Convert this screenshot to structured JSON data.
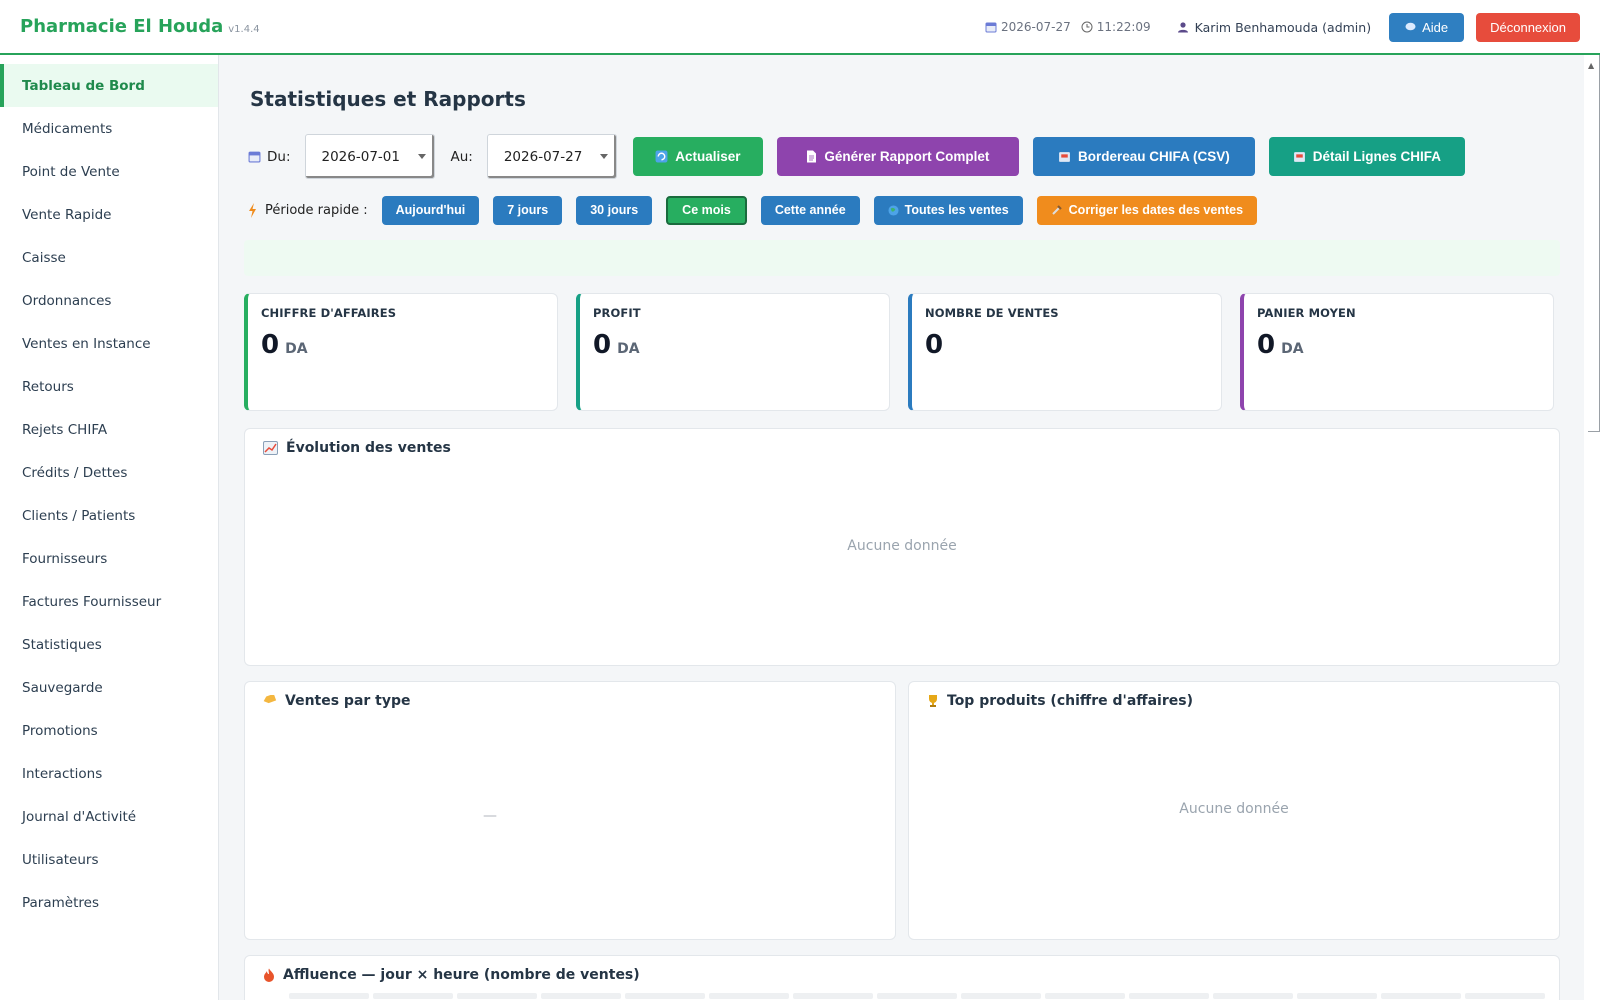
{
  "header": {
    "app_name": "Pharmacie El Houda",
    "version": "v1.4.4",
    "date": "2026-07-27",
    "time": "11:22:09",
    "user": "Karim Benhamouda (admin)",
    "help_label": "Aide",
    "logout_label": "Déconnexion"
  },
  "sidebar": {
    "items": [
      {
        "label": "Tableau de Bord"
      },
      {
        "label": "Médicaments"
      },
      {
        "label": "Point de Vente"
      },
      {
        "label": "Vente Rapide"
      },
      {
        "label": "Caisse"
      },
      {
        "label": "Ordonnances"
      },
      {
        "label": "Ventes en Instance"
      },
      {
        "label": "Retours"
      },
      {
        "label": "Rejets CHIFA"
      },
      {
        "label": "Crédits / Dettes"
      },
      {
        "label": "Clients / Patients"
      },
      {
        "label": "Fournisseurs"
      },
      {
        "label": "Factures Fournisseur"
      },
      {
        "label": "Statistiques"
      },
      {
        "label": "Sauvegarde"
      },
      {
        "label": "Promotions"
      },
      {
        "label": "Interactions"
      },
      {
        "label": "Journal d'Activité"
      },
      {
        "label": "Utilisateurs"
      },
      {
        "label": "Paramètres"
      }
    ],
    "active_index": 0
  },
  "page": {
    "title": "Statistiques et Rapports"
  },
  "filters": {
    "from_label": "Du:",
    "from_value": "2026-07-01",
    "to_label": "Au:",
    "to_value": "2026-07-27",
    "refresh_label": "Actualiser",
    "report_label": "Générer Rapport Complet",
    "chifa_csv_label": "Bordereau CHIFA (CSV)",
    "chifa_detail_label": "Détail Lignes CHIFA"
  },
  "quick": {
    "label": "Période rapide :",
    "today": "Aujourd'hui",
    "days7": "7 jours",
    "days30": "30 jours",
    "month": "Ce mois",
    "year": "Cette année",
    "all": "Toutes les ventes",
    "fix_dates": "Corriger les dates des ventes",
    "active": "month"
  },
  "kpis": {
    "revenue": {
      "label": "CHIFFRE D'AFFAIRES",
      "value": "0",
      "unit": "DA",
      "color": "#27ae60"
    },
    "profit": {
      "label": "PROFIT",
      "value": "0",
      "unit": "DA",
      "color": "#16a085"
    },
    "sales_count": {
      "label": "NOMBRE DE VENTES",
      "value": "0",
      "color": "#2b7bbf"
    },
    "avg_basket": {
      "label": "PANIER MOYEN",
      "value": "0",
      "unit": "DA",
      "color": "#8e44ad"
    }
  },
  "cards": {
    "evolution": {
      "title": "Évolution des ventes",
      "empty": "Aucune donnée"
    },
    "by_type": {
      "title": "Ventes par type",
      "placeholder": "—"
    },
    "top_products": {
      "title": "Top produits (chiffre d'affaires)",
      "empty": "Aucune donnée"
    },
    "affluence": {
      "title": "Affluence — jour × heure (nombre de ventes)"
    }
  },
  "colors": {
    "accent": "#27a35a",
    "danger": "#e74c3c",
    "info": "#2b7bbf",
    "purple": "#8e44ad",
    "teal": "#16a085",
    "orange": "#f08c1d"
  }
}
